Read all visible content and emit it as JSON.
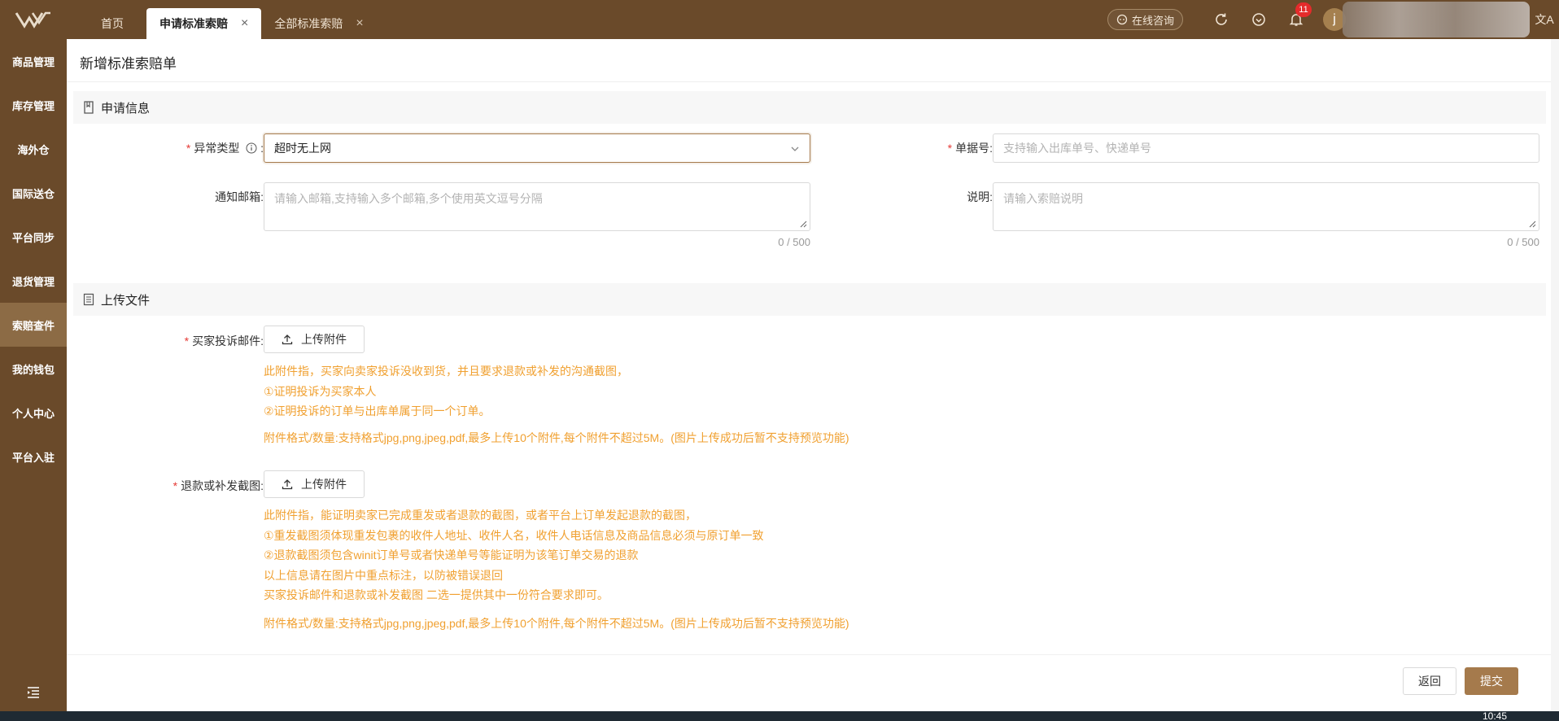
{
  "header": {
    "tabs": [
      {
        "label": "首页"
      },
      {
        "label": "申请标准索赔"
      },
      {
        "label": "全部标准索赔"
      }
    ],
    "consult_label": "在线咨询",
    "notification_count": "11",
    "avatar_letter": "j",
    "lang_label": "文A"
  },
  "sidebar": {
    "items": [
      {
        "label": "商品管理"
      },
      {
        "label": "库存管理"
      },
      {
        "label": "海外仓"
      },
      {
        "label": "国际送仓"
      },
      {
        "label": "平台同步"
      },
      {
        "label": "退货管理"
      },
      {
        "label": "索赔查件"
      },
      {
        "label": "我的钱包"
      },
      {
        "label": "个人中心"
      },
      {
        "label": "平台入驻"
      }
    ]
  },
  "page": {
    "title": "新增标准索赔单",
    "apply_section": {
      "title": "申请信息",
      "exception_type_label": "异常类型",
      "exception_type_value": "超时无上网",
      "order_no_label": "单据号",
      "order_no_placeholder": "支持输入出库单号、快递单号",
      "email_label": "通知邮箱",
      "email_placeholder": "请输入邮箱,支持输入多个邮箱,多个使用英文逗号分隔",
      "email_counter": "0 / 500",
      "desc_label": "说明",
      "desc_placeholder": "请输入索赔说明",
      "desc_counter": "0 / 500"
    },
    "upload_section": {
      "title": "上传文件",
      "complaint_label": "买家投诉邮件",
      "upload_label": "上传附件",
      "complaint_hints": [
        "此附件指，买家向卖家投诉没收到货，并且要求退款或补发的沟通截图，",
        "①证明投诉为买家本人",
        "②证明投诉的订单与出库单属于同一个订单。"
      ],
      "format_hint": "附件格式/数量:支持格式jpg,png,jpeg,pdf,最多上传10个附件,每个附件不超过5M。(图片上传成功后暂不支持预览功能)",
      "refund_label": "退款或补发截图",
      "refund_hints": [
        "此附件指，能证明卖家已完成重发或者退款的截图，或者平台上订单发起退款的截图，",
        "①重发截图须体现重发包裹的收件人地址、收件人名，收件人电话信息及商品信息必须与原订单一致",
        "②退款截图须包含winit订单号或者快递单号等能证明为该笔订单交易的退款",
        "以上信息请在图片中重点标注，以防被错误退回",
        "买家投诉邮件和退款或补发截图 二选一提供其中一份符合要求即可。"
      ]
    },
    "back_label": "返回",
    "submit_label": "提交"
  },
  "taskbar": {
    "clock": "10:45"
  }
}
